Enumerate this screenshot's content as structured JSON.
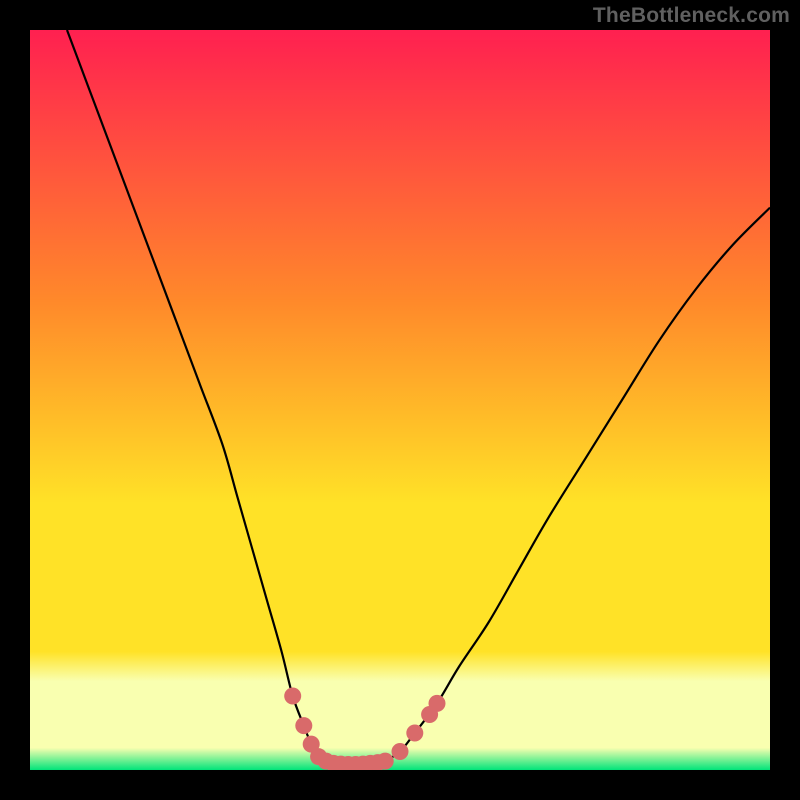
{
  "watermark": "TheBottleneck.com",
  "colors": {
    "frame": "#000000",
    "grad_top": "#ff2050",
    "grad_mid1": "#ff8a2a",
    "grad_mid2": "#ffe227",
    "grad_band": "#f9ffb0",
    "grad_bottom": "#00e47a",
    "curve": "#000000",
    "markers": "#d96a6a"
  },
  "chart_data": {
    "type": "line",
    "title": "",
    "xlabel": "",
    "ylabel": "",
    "x_range": [
      0,
      100
    ],
    "y_range": [
      0,
      100
    ],
    "series": [
      {
        "name": "left-branch",
        "x": [
          5,
          8,
          11,
          14,
          17,
          20,
          23,
          26,
          28,
          30,
          32,
          34,
          35.5,
          37,
          38,
          39,
          40
        ],
        "y": [
          100,
          92,
          84,
          76,
          68,
          60,
          52,
          44,
          37,
          30,
          23,
          16,
          10,
          6,
          3.5,
          1.8,
          1.2
        ]
      },
      {
        "name": "valley-floor",
        "x": [
          40,
          41,
          42,
          43,
          44,
          45,
          46,
          47,
          48
        ],
        "y": [
          1.2,
          0.9,
          0.8,
          0.75,
          0.75,
          0.8,
          0.9,
          1.0,
          1.2
        ]
      },
      {
        "name": "right-branch",
        "x": [
          48,
          50,
          52,
          55,
          58,
          62,
          66,
          70,
          75,
          80,
          85,
          90,
          95,
          100
        ],
        "y": [
          1.2,
          2.5,
          5,
          9,
          14,
          20,
          27,
          34,
          42,
          50,
          58,
          65,
          71,
          76
        ]
      }
    ],
    "markers": {
      "name": "highlight-points",
      "points": [
        {
          "x": 35.5,
          "y": 10
        },
        {
          "x": 37,
          "y": 6
        },
        {
          "x": 38,
          "y": 3.5
        },
        {
          "x": 39,
          "y": 1.8
        },
        {
          "x": 40,
          "y": 1.2
        },
        {
          "x": 41,
          "y": 0.9
        },
        {
          "x": 42,
          "y": 0.8
        },
        {
          "x": 43,
          "y": 0.75
        },
        {
          "x": 44,
          "y": 0.75
        },
        {
          "x": 45,
          "y": 0.8
        },
        {
          "x": 46,
          "y": 0.9
        },
        {
          "x": 47,
          "y": 1.0
        },
        {
          "x": 48,
          "y": 1.2
        },
        {
          "x": 50,
          "y": 2.5
        },
        {
          "x": 52,
          "y": 5
        },
        {
          "x": 54,
          "y": 7.5
        },
        {
          "x": 55,
          "y": 9
        }
      ]
    },
    "gradient_stops_pct": [
      0,
      37,
      64,
      83,
      89,
      100
    ]
  }
}
